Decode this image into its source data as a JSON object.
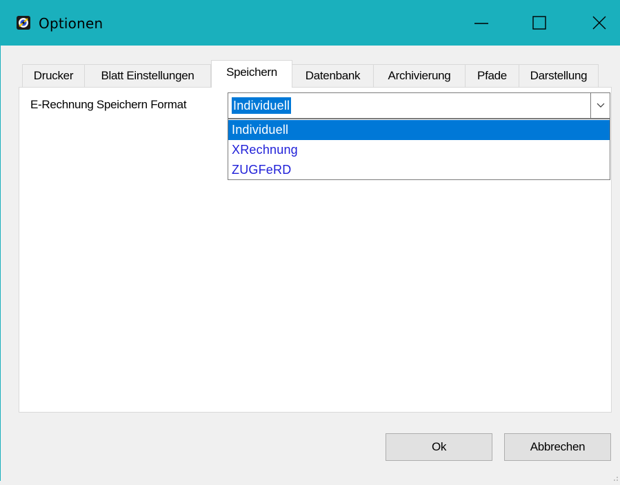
{
  "window": {
    "title": "Optionen",
    "titlebar_color": "#1ab0bd",
    "controls": [
      "minimize-icon",
      "maximize-icon",
      "close-icon"
    ]
  },
  "tabs": [
    {
      "label": "Drucker",
      "active": false
    },
    {
      "label": "Blatt Einstellungen",
      "active": false
    },
    {
      "label": "Speichern",
      "active": true
    },
    {
      "label": "Datenbank",
      "active": false
    },
    {
      "label": "Archivierung",
      "active": false
    },
    {
      "label": "Pfade",
      "active": false
    },
    {
      "label": "Darstellung",
      "active": false
    }
  ],
  "speichern": {
    "format_label": "E-Rechnung Speichern Format",
    "format_value": "Individuell",
    "options": [
      "Individuell",
      "XRechnung",
      "ZUGFeRD"
    ],
    "selected_option": "Individuell"
  },
  "buttons": {
    "ok": "Ok",
    "cancel": "Abbrechen"
  },
  "colors": {
    "selection": "#0078d7",
    "option_text": "#1e1ed8"
  }
}
